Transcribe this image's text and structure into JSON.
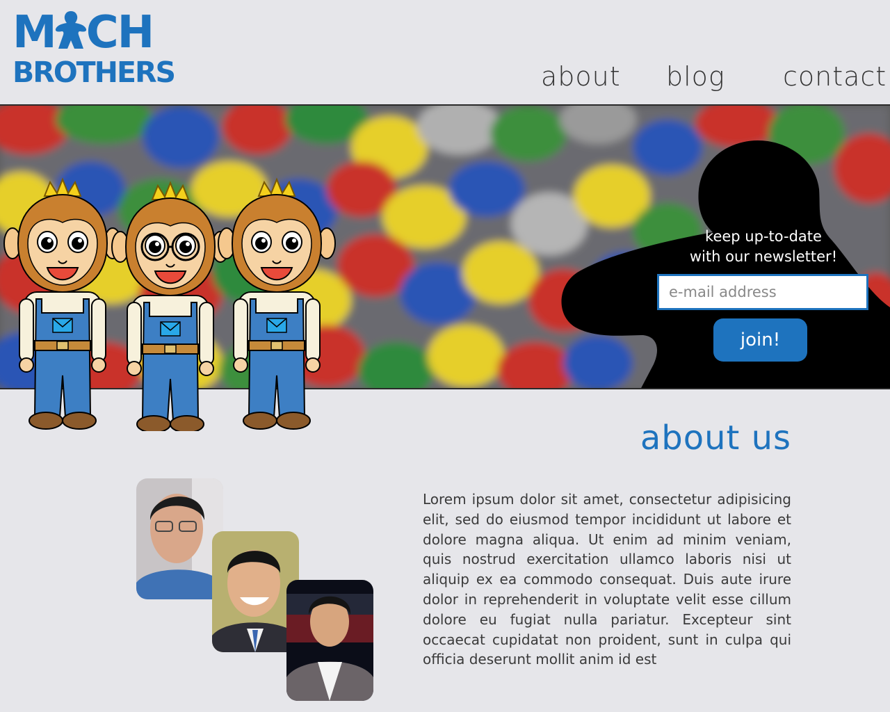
{
  "header": {
    "logo": {
      "line1": "MACH",
      "line2": "BROTHERS"
    },
    "nav": {
      "about": "about",
      "blog": "blog",
      "contact": "contact"
    }
  },
  "hero": {
    "newsletter": {
      "line1": "keep up-to-date",
      "line2": "with our newsletter!",
      "email_placeholder": "e-mail address",
      "join_label": "join!"
    }
  },
  "about": {
    "title": "about us",
    "body": "Lorem ipsum dolor sit amet, consectetur adipisicing elit, sed do eiusmod tempor incididunt ut labore et dolore magna aliqua. Ut enim ad minim veniam, quis nostrud exercitation ullamco laboris nisi ut aliquip ex ea commodo consequat. Duis aute irure dolor in reprehenderit in voluptate velit esse cillum dolore eu fugiat nulla pariatur. Excepteur sint occaecat cupidatat non proident, sunt in culpa qui officia deserunt mollit anim id est"
  },
  "colors": {
    "brand_blue": "#1e73be",
    "page_background": "#e6e6ea",
    "text_dark": "#333333"
  },
  "icons": {
    "logo_letter_a": "meeple-icon",
    "newsletter_backdrop": "meeple-silhouette"
  }
}
